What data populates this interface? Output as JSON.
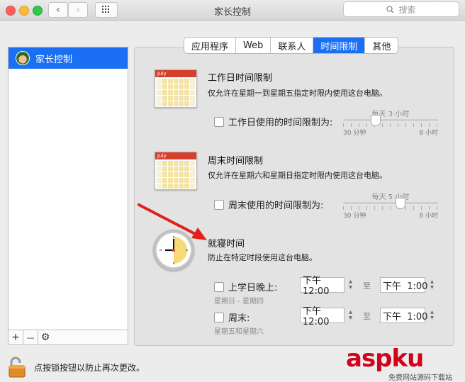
{
  "window": {
    "title": "家长控制",
    "search_placeholder": "搜索",
    "icons": {
      "back": "chevron-left-icon",
      "forward": "chevron-right-icon",
      "grid": "grid-icon",
      "search": "search-icon"
    }
  },
  "sidebar": {
    "items": [
      {
        "label": "家长控制",
        "selected": true
      }
    ],
    "tools": {
      "add": "+",
      "remove": "—",
      "settings": "⚙"
    }
  },
  "tabs": [
    {
      "label": "应用程序",
      "active": false
    },
    {
      "label": "Web",
      "active": false
    },
    {
      "label": "联系人",
      "active": false
    },
    {
      "label": "时间限制",
      "active": true
    },
    {
      "label": "其他",
      "active": false
    }
  ],
  "weekday": {
    "title": "工作日时间限制",
    "description": "仅允许在星期一到星期五指定时限内使用这台电脑。",
    "checkbox_label": "工作日使用的时间限制为:",
    "checked": false,
    "calendar_month": "July",
    "slider": {
      "label": "每天 3 小时",
      "min_label": "30 分钟",
      "max_label": "8 小时",
      "value_hours": 3
    }
  },
  "weekend": {
    "title": "周末时间限制",
    "description": "仅允许在星期六和星期日指定时限内使用这台电脑。",
    "checkbox_label": "周末使用的时间限制为:",
    "checked": false,
    "calendar_month": "July",
    "slider": {
      "label": "每天 5 小时",
      "min_label": "30 分钟",
      "max_label": "8 小时",
      "value_hours": 5
    }
  },
  "bedtime": {
    "title": "就寝时间",
    "description": "防止在特定时段使用这台电脑。",
    "school_nights": {
      "label": "上学日晚上:",
      "checked": false,
      "sub": "星期日 - 星期四",
      "from": "下午12:00",
      "to_word": "至",
      "to": "下午  1:00"
    },
    "weekend": {
      "label": "周末:",
      "checked": false,
      "sub": "星期五和星期六",
      "from": "下午12:00",
      "to_word": "至",
      "to": "下午  1:00"
    }
  },
  "footer": {
    "lock_text": "点按锁按钮以防止再次更改。",
    "lock_icon": "lock-open-icon"
  },
  "watermark": {
    "main": "aspku",
    "sub": "免费网站源码下载站"
  },
  "colors": {
    "accent": "#1b6ff2",
    "arrow": "#e3201b"
  }
}
